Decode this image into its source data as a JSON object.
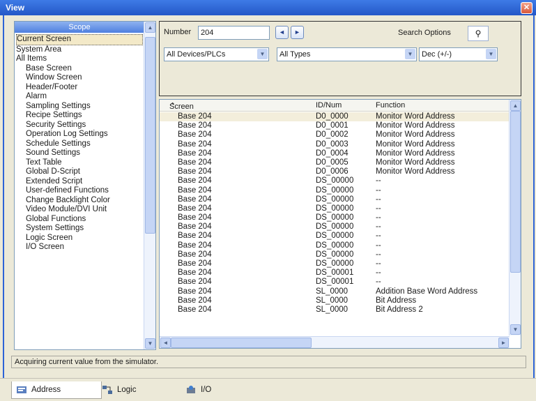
{
  "window": {
    "title": "View"
  },
  "tree": {
    "header": "Scope",
    "items": [
      {
        "label": "Current Screen",
        "indent": 0,
        "selected": true
      },
      {
        "label": "System Area",
        "indent": 0
      },
      {
        "label": "All Items",
        "indent": 0
      },
      {
        "label": "Base Screen",
        "indent": 1
      },
      {
        "label": "Window Screen",
        "indent": 1
      },
      {
        "label": "Header/Footer",
        "indent": 1
      },
      {
        "label": "Alarm",
        "indent": 1
      },
      {
        "label": "Sampling Settings",
        "indent": 1
      },
      {
        "label": "Recipe Settings",
        "indent": 1
      },
      {
        "label": "Security Settings",
        "indent": 1
      },
      {
        "label": "Operation Log Settings",
        "indent": 1
      },
      {
        "label": "Schedule Settings",
        "indent": 1
      },
      {
        "label": "Sound Settings",
        "indent": 1
      },
      {
        "label": "Text Table",
        "indent": 1
      },
      {
        "label": "Global D-Script",
        "indent": 1
      },
      {
        "label": "Extended Script",
        "indent": 1
      },
      {
        "label": "User-defined Functions",
        "indent": 1
      },
      {
        "label": "Change Backlight Color",
        "indent": 1
      },
      {
        "label": "Video Module/DVI Unit",
        "indent": 1
      },
      {
        "label": "Global Functions",
        "indent": 1
      },
      {
        "label": "System Settings",
        "indent": 1
      },
      {
        "label": "Logic Screen",
        "indent": 1
      },
      {
        "label": "I/O Screen",
        "indent": 1
      }
    ]
  },
  "search": {
    "number_label": "Number",
    "number_value": "204",
    "search_options_label": "Search Options",
    "device_filter": "All Devices/PLCs",
    "type_filter": "All Types",
    "format_filter": "Dec (+/-)"
  },
  "results": {
    "columns": [
      "Screen",
      "ID/Num",
      "Function"
    ],
    "rows": [
      {
        "screen": "Base 204",
        "id": "D0_0000",
        "func": "Monitor Word Address"
      },
      {
        "screen": "Base 204",
        "id": "D0_0001",
        "func": "Monitor Word Address"
      },
      {
        "screen": "Base 204",
        "id": "D0_0002",
        "func": "Monitor Word Address"
      },
      {
        "screen": "Base 204",
        "id": "D0_0003",
        "func": "Monitor Word Address"
      },
      {
        "screen": "Base 204",
        "id": "D0_0004",
        "func": "Monitor Word Address"
      },
      {
        "screen": "Base 204",
        "id": "D0_0005",
        "func": "Monitor Word Address"
      },
      {
        "screen": "Base 204",
        "id": "D0_0006",
        "func": "Monitor Word Address"
      },
      {
        "screen": "Base 204",
        "id": "DS_00000",
        "func": "--"
      },
      {
        "screen": "Base 204",
        "id": "DS_00000",
        "func": "--"
      },
      {
        "screen": "Base 204",
        "id": "DS_00000",
        "func": "--"
      },
      {
        "screen": "Base 204",
        "id": "DS_00000",
        "func": "--"
      },
      {
        "screen": "Base 204",
        "id": "DS_00000",
        "func": "--"
      },
      {
        "screen": "Base 204",
        "id": "DS_00000",
        "func": "--"
      },
      {
        "screen": "Base 204",
        "id": "DS_00000",
        "func": "--"
      },
      {
        "screen": "Base 204",
        "id": "DS_00000",
        "func": "--"
      },
      {
        "screen": "Base 204",
        "id": "DS_00000",
        "func": "--"
      },
      {
        "screen": "Base 204",
        "id": "DS_00000",
        "func": "--"
      },
      {
        "screen": "Base 204",
        "id": "DS_00001",
        "func": "--"
      },
      {
        "screen": "Base 204",
        "id": "DS_00001",
        "func": "--"
      },
      {
        "screen": "Base 204",
        "id": "SL_0000",
        "func": "Addition Base Word Address"
      },
      {
        "screen": "Base 204",
        "id": "SL_0000",
        "func": "Bit Address"
      },
      {
        "screen": "Base 204",
        "id": "SL_0000",
        "func": "Bit Address 2"
      }
    ]
  },
  "status_text": "Acquiring current value from the simulator.",
  "tabs": [
    {
      "label": "Address",
      "icon": "address-icon"
    },
    {
      "label": "Logic",
      "icon": "logic-icon"
    },
    {
      "label": "I/O",
      "icon": "io-icon"
    }
  ]
}
